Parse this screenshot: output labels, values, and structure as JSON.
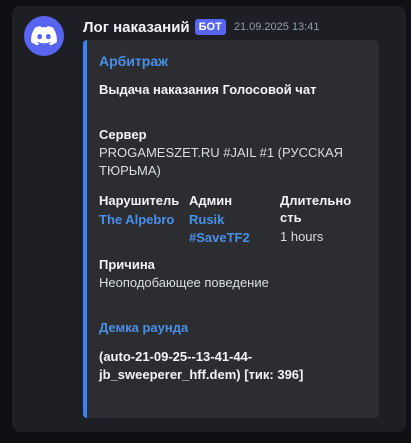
{
  "message": {
    "username": "Лог наказаний",
    "bot_tag": "БОТ",
    "timestamp": "21.09.2025 13:41"
  },
  "embed": {
    "author": "Арбитраж",
    "title": "Выдача наказания Голосовой чат",
    "server": {
      "name": "Сервер",
      "value": "PROGAMESZET.RU #JAIL #1 (РУССКАЯ ТЮРЬМА)"
    },
    "violator": {
      "name": "Нарушитель",
      "value": "The Alpebro"
    },
    "admin": {
      "name": "Админ",
      "value": "Rusik #SaveTF2"
    },
    "duration": {
      "name": "Длительность",
      "value": "1 hours"
    },
    "reason": {
      "name": "Причина",
      "value": "Неоподобающее поведение"
    },
    "demo": {
      "link": "Демка раунда",
      "value": "(auto-21-09-25--13-41-44-jb_sweeperer_hff.dem) [тик: 396]"
    }
  },
  "colors": {
    "accent": "#5865f2",
    "embed_border": "#3b82f6",
    "link": "#4a8fe8"
  },
  "icons": {
    "avatar": "discord-logo-icon"
  }
}
